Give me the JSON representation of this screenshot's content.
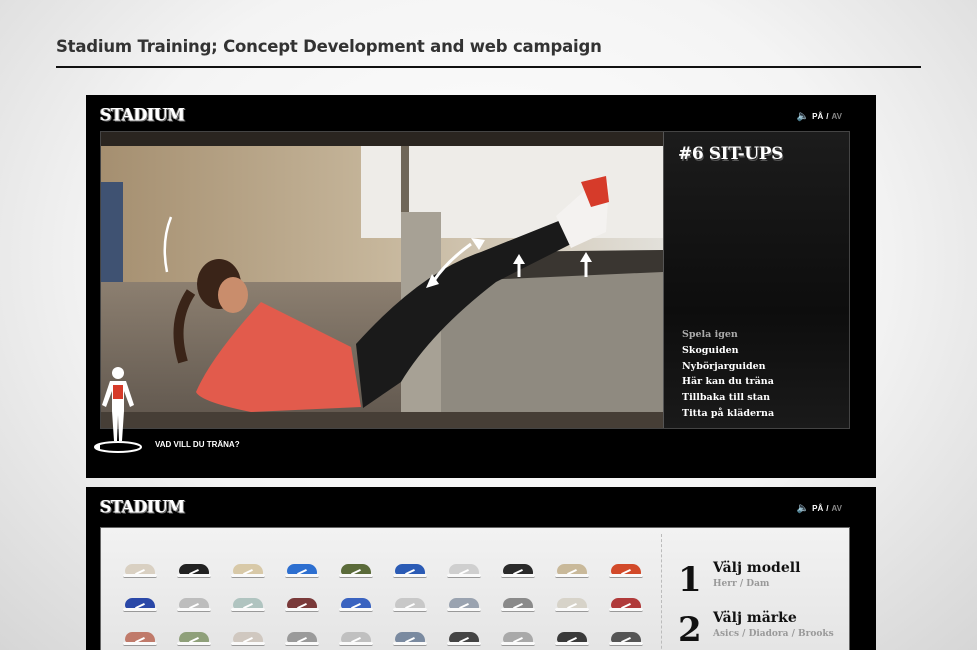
{
  "document": {
    "title": "Stadium Training; Concept Development and web campaign"
  },
  "screen1": {
    "logo": "STADIUM",
    "sound": {
      "on": "PÅ",
      "separator": "/",
      "off": "AV"
    },
    "exercise_title": "#6 SIT-UPS",
    "menu": [
      {
        "label": "Spela igen",
        "dim": true
      },
      {
        "label": "Skoguiden",
        "dim": false
      },
      {
        "label": "Nybörjarguiden",
        "dim": false
      },
      {
        "label": "Här kan du träna",
        "dim": false
      },
      {
        "label": "Tillbaka till stan",
        "dim": false
      },
      {
        "label": "Titta på kläderna",
        "dim": false
      }
    ],
    "prompt": "VAD VILL DU TRÄNA?",
    "icons": [
      "speaker-icon",
      "body-figure-icon",
      "rotate-arrow-icon"
    ]
  },
  "screen2": {
    "logo": "STADIUM",
    "sound": {
      "on": "PÅ",
      "separator": "/",
      "off": "AV"
    },
    "steps": [
      {
        "number": "1",
        "title": "Välj modell",
        "sub": "Herr / Dam"
      },
      {
        "number": "2",
        "title": "Välj märke",
        "sub": "Asics / Diadora / Brooks"
      }
    ],
    "shoe_colors": [
      [
        "#d9d0c2",
        "#222222",
        "#d8c9a8",
        "#2d6fd0",
        "#5b6b3a",
        "#2b5bb5",
        "#cfcfcf",
        "#2a2a2a",
        "#c9b99a",
        "#d24a2a"
      ],
      [
        "#2a48a8",
        "#bdbdbd",
        "#b0c4c0",
        "#7a3a3a",
        "#3a63c0",
        "#c8c8c8",
        "#9aa3b0",
        "#8a8a8a",
        "#d7d3c9",
        "#b03a3a"
      ],
      [
        "#c07a6a",
        "#8fa07a",
        "#d0c8c0",
        "#9a9a9a",
        "#c0c0c0",
        "#7a8aa0",
        "#444444",
        "#a9a9a9",
        "#3a3a3a",
        "#555555"
      ]
    ]
  }
}
